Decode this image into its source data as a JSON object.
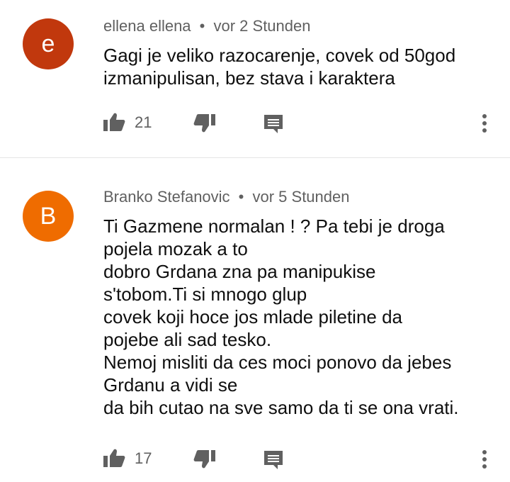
{
  "comments": [
    {
      "avatar_letter": "e",
      "avatar_color": "#c1380d",
      "author": "ellena ellena",
      "separator": "•",
      "time": "vor 2 Stunden",
      "lines": [
        "Gagi je veliko razocarenje, covek od 50god",
        "izmanipulisan, bez stava i karaktera"
      ],
      "like_count": "21"
    },
    {
      "avatar_letter": "B",
      "avatar_color": "#ef6c00",
      "author": "Branko Stefanovic",
      "separator": "•",
      "time": "vor 5 Stunden",
      "lines": [
        "Ti Gazmene normalan !  ?  Pa tebi je droga",
        "pojela mozak a to",
        "dobro Grdana zna pa manipukise",
        "s'tobom.Ti si mnogo glup",
        "covek koji hoce jos mlade piletine da",
        "pojebe ali sad tesko.",
        "Nemoj misliti da ces moci ponovo da jebes",
        "Grdanu a vidi se",
        "da bih cutao na sve samo da ti se ona vrati."
      ],
      "like_count": "17"
    }
  ],
  "icons": {
    "like": "thumb-up-icon",
    "dislike": "thumb-down-icon",
    "reply": "comment-reply-icon",
    "more": "more-vert-icon"
  },
  "colors": {
    "icon_gray": "#606060",
    "divider": "#e5e5e5"
  }
}
